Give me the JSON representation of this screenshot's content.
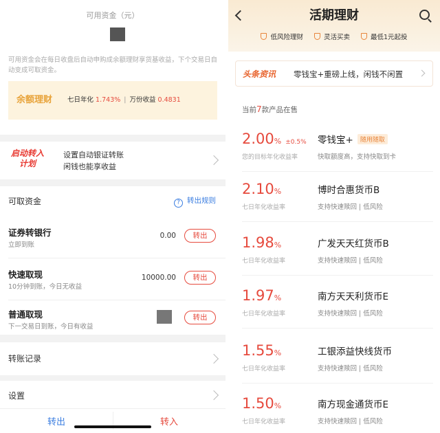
{
  "left": {
    "available_label": "可用资金（元）",
    "note": "可用资金会在每日收盘后自动申购成余额理财享货基收益，下个交易日自动变成可取资金。",
    "yue": {
      "title": "余额理财",
      "rate_label": "七日年化",
      "rate_value": "1.743%",
      "income_label": "万份收益",
      "income_value": "0.4831"
    },
    "auto_transfer": {
      "logo_line1": "启动转入",
      "logo_line2": "计划",
      "line1": "设置自动银证转账",
      "line2": "闲钱也能享收益"
    },
    "withdraw": {
      "heading": "可取资金",
      "rule_link": "转出规则",
      "rows": [
        {
          "title": "证券转银行",
          "subtitle": "立即到账",
          "amount": "0.00",
          "button": "转出"
        },
        {
          "title": "快速取现",
          "subtitle": "10分钟到账，今日无收益",
          "amount": "10000.00",
          "button": "转出"
        },
        {
          "title": "普通取现",
          "subtitle": "下一交易日到账，今日有收益",
          "amount": "",
          "button": "转出"
        }
      ]
    },
    "records": "转账记录",
    "settings": "设置",
    "bottom": {
      "out": "转出",
      "in": "转入"
    }
  },
  "right": {
    "title": "活期理财",
    "features": [
      "低风险理财",
      "灵活买卖",
      "最低1元起投"
    ],
    "news_tag": "头条资讯",
    "news_text": "零钱宝+重磅上线，闲钱不闲置",
    "count_prefix": "当前",
    "count": "7",
    "count_suffix": "款产品在售",
    "products": [
      {
        "rate": "2.00",
        "pct": "%",
        "delta": "±0.5%",
        "rate_label": "您的目标年化收益率",
        "name": "零钱宝+",
        "badge": "随用随取",
        "desc": "快取额度高，支持快取到卡"
      },
      {
        "rate": "2.10",
        "pct": "%",
        "delta": "",
        "rate_label": "七日年化收益率",
        "name": "博时合惠货币B",
        "badge": "",
        "desc": "支持快速赎回 | 低风险"
      },
      {
        "rate": "1.98",
        "pct": "%",
        "delta": "",
        "rate_label": "七日年化收益率",
        "name": "广发天天红货币B",
        "badge": "",
        "desc": "支持快速赎回 | 低风险"
      },
      {
        "rate": "1.97",
        "pct": "%",
        "delta": "",
        "rate_label": "七日年化收益率",
        "name": "南方天天利货币E",
        "badge": "",
        "desc": "支持快速赎回 | 低风险"
      },
      {
        "rate": "1.55",
        "pct": "%",
        "delta": "",
        "rate_label": "七日年化收益率",
        "name": "工银添益快线货币",
        "badge": "",
        "desc": "支持快速赎回 | 低风险"
      },
      {
        "rate": "1.50",
        "pct": "%",
        "delta": "",
        "rate_label": "七日年化收益率",
        "name": "南方现金通货币E",
        "badge": "",
        "desc": "支持快速赎回 | 低风险"
      }
    ]
  },
  "colors": {
    "accent_red": "#e64a3d",
    "link_blue": "#3a7de0",
    "gold": "#e8a33a"
  }
}
